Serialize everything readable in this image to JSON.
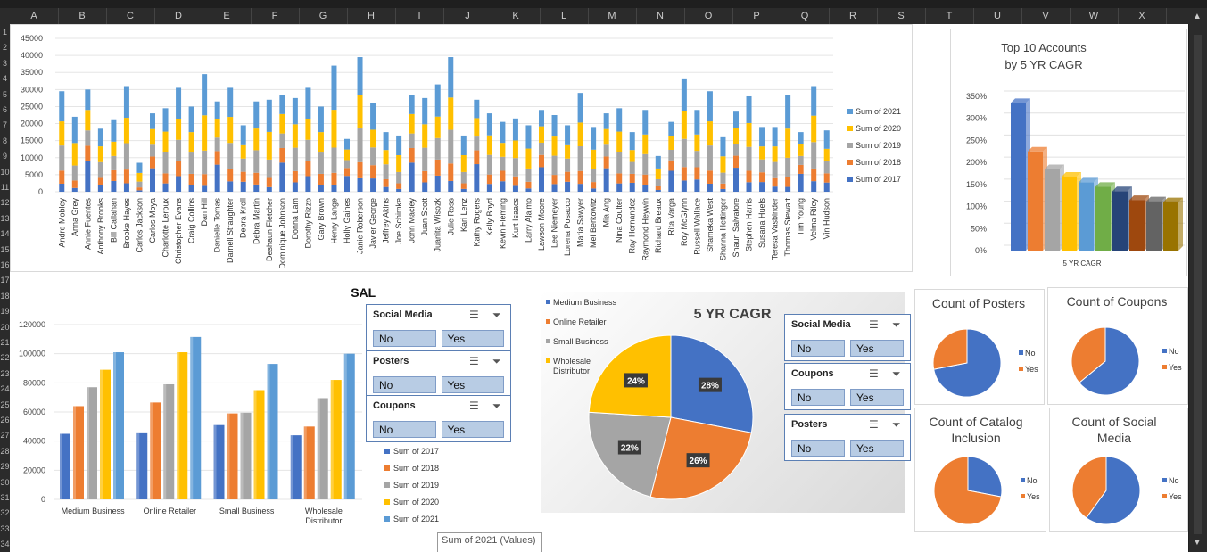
{
  "columns": [
    "A",
    "B",
    "C",
    "D",
    "E",
    "F",
    "G",
    "H",
    "I",
    "J",
    "K",
    "L",
    "M",
    "N",
    "O",
    "P",
    "Q",
    "R",
    "S",
    "T",
    "U",
    "V",
    "W",
    "X"
  ],
  "rows": [
    "1",
    "2",
    "3",
    "4",
    "5",
    "6",
    "7",
    "8",
    "9",
    "10",
    "11",
    "12",
    "13",
    "14",
    "15",
    "16",
    "17",
    "18",
    "19",
    "20",
    "21",
    "22",
    "23",
    "24",
    "25",
    "26",
    "27",
    "28",
    "29",
    "30",
    "31",
    "32",
    "33",
    "34"
  ],
  "colors": {
    "s2017": "#4472C4",
    "s2018": "#ED7D31",
    "s2019": "#A5A5A5",
    "s2020": "#FFC000",
    "s2021": "#5B9BD5"
  },
  "stacked_chart": {
    "yticks": [
      "45000",
      "40000",
      "35000",
      "30000",
      "25000",
      "20000",
      "15000",
      "10000",
      "5000",
      "0"
    ],
    "legend": [
      "Sum of 2021",
      "Sum of 2020",
      "Sum of 2019",
      "Sum of 2018",
      "Sum of 2017"
    ]
  },
  "chart_data": [
    {
      "type": "bar",
      "stacked": true,
      "ylim": [
        0,
        45000
      ],
      "categories": [
        "Andre Mobley",
        "Anna Grey",
        "Annie Fuentes",
        "Anthony Brooks",
        "Bill Callahan",
        "Brooke Hayes",
        "Carlos Jackson",
        "Carlos Moya",
        "Charlotte Leroux",
        "Christopher Evans",
        "Craig Collins",
        "Dan Hill",
        "Danielle Tomas",
        "Darnell Straughter",
        "Debra Kroll",
        "Debra Martin",
        "Deshaun Fletcher",
        "Dominique Johnson",
        "Donna Lam",
        "Dorothy Rizzo",
        "Gary Brown",
        "Henry Lange",
        "Holly Gaines",
        "Janie Roberson",
        "Javier George",
        "Jeffrey Akins",
        "Joe Schimke",
        "John Macley",
        "Juan Scott",
        "Juanita Wisozk",
        "Julie Ross",
        "Kari Lenz",
        "Kathy Rogers",
        "Kelly Boyd",
        "Kevin Fleming",
        "Kurt Isaacs",
        "Larry Alaimo",
        "Lawson Moore",
        "Lee Niemeyer",
        "Lorena Posacco",
        "Maria Sawyer",
        "Mel Berkowitz",
        "Mia Ang",
        "Nina Coulter",
        "Ray Hernandez",
        "Raymond Heywin",
        "Richard Breaux",
        "Rita Varga",
        "Roy McGlynn",
        "Russell Wallace",
        "Shameka West",
        "Shanna Hettinger",
        "Shaun Salvatore",
        "Stephen Harris",
        "Susana Huels",
        "Teresa Vasbinder",
        "Thomas Stewart",
        "Tim Young",
        "Velma Riley",
        "Vin Hudson"
      ],
      "totals": [
        29500,
        22000,
        30000,
        18500,
        21000,
        31000,
        8500,
        23000,
        24500,
        30500,
        25000,
        34500,
        26500,
        30500,
        19500,
        26500,
        27000,
        28500,
        27500,
        30500,
        25000,
        37000,
        15500,
        39500,
        26000,
        17500,
        16500,
        28500,
        27500,
        31500,
        39500,
        16500,
        27000,
        23000,
        20500,
        21500,
        19500,
        24000,
        22500,
        19500,
        29000,
        19000,
        23000,
        24500,
        17500,
        24000,
        10500,
        20500,
        33000,
        24000,
        29500,
        16000,
        23500,
        28000,
        19000,
        19000,
        28500,
        17500,
        31000,
        18000
      ],
      "series": [
        {
          "name": "Sum of 2017"
        },
        {
          "name": "Sum of 2018"
        },
        {
          "name": "Sum of 2019"
        },
        {
          "name": "Sum of 2020"
        },
        {
          "name": "Sum of 2021"
        }
      ]
    },
    {
      "type": "bar",
      "title": "Top 10 Accounts by 5 YR CAGR",
      "xlabel": "5 YR CAGR",
      "ylim": [
        0,
        3.5
      ],
      "yticks": [
        "350%",
        "300%",
        "250%",
        "200%",
        "150%",
        "100%",
        "50%",
        "0%"
      ],
      "values": [
        3.35,
        2.25,
        1.85,
        1.68,
        1.55,
        1.45,
        1.35,
        1.15,
        1.12,
        1.1
      ],
      "colors": [
        "#4472C4",
        "#ED7D31",
        "#A5A5A5",
        "#FFC000",
        "#5B9BD5",
        "#70AD47",
        "#264478",
        "#9E480E",
        "#636363",
        "#997300"
      ]
    },
    {
      "type": "bar",
      "title": "SALES BY ACCOUNT TYPE",
      "ylim": [
        0,
        120000
      ],
      "yticks": [
        "120000",
        "100000",
        "80000",
        "60000",
        "40000",
        "20000",
        "0"
      ],
      "categories": [
        "Medium Business",
        "Online Retailer",
        "Small Business",
        "Wholesale Distributor"
      ],
      "series": [
        {
          "name": "Sum of 2017",
          "values": [
            45000,
            46000,
            51000,
            44000
          ]
        },
        {
          "name": "Sum of 2018",
          "values": [
            64000,
            66500,
            59000,
            50000
          ]
        },
        {
          "name": "Sum of 2019",
          "values": [
            77000,
            79000,
            59500,
            69500
          ]
        },
        {
          "name": "Sum of 2020",
          "values": [
            89000,
            101000,
            75000,
            82000
          ]
        },
        {
          "name": "Sum of 2021",
          "values": [
            101000,
            111500,
            93000,
            100000
          ]
        }
      ]
    },
    {
      "type": "pie",
      "title": "5 YR CAGR",
      "categories": [
        "Medium Business",
        "Online Retailer",
        "Small Business",
        "Wholesale Distributor"
      ],
      "labels": [
        "28%",
        "26%",
        "22%",
        "24%"
      ],
      "values": [
        28,
        26,
        22,
        24
      ]
    },
    {
      "type": "pie",
      "title": "Count of Posters",
      "categories": [
        "No",
        "Yes"
      ],
      "values": [
        72,
        28
      ]
    },
    {
      "type": "pie",
      "title": "Count of Coupons",
      "categories": [
        "No",
        "Yes"
      ],
      "values": [
        64,
        36
      ]
    },
    {
      "type": "pie",
      "title": "Count of Catalog Inclusion",
      "categories": [
        "No",
        "Yes"
      ],
      "values": [
        28,
        72
      ]
    },
    {
      "type": "pie",
      "title": "Count of Social Media",
      "categories": [
        "No",
        "Yes"
      ],
      "values": [
        60,
        40
      ]
    }
  ],
  "slicers_left": [
    {
      "title": "Social Media",
      "no": "No",
      "yes": "Yes"
    },
    {
      "title": "Posters",
      "no": "No",
      "yes": "Yes"
    },
    {
      "title": "Coupons",
      "no": "No",
      "yes": "Yes"
    }
  ],
  "slicers_right": [
    {
      "title": "Social Media",
      "no": "No",
      "yes": "Yes"
    },
    {
      "title": "Coupons",
      "no": "No",
      "yes": "Yes"
    },
    {
      "title": "Posters",
      "no": "No",
      "yes": "Yes"
    }
  ],
  "tooltip": "Sum of 2021 (Values)"
}
